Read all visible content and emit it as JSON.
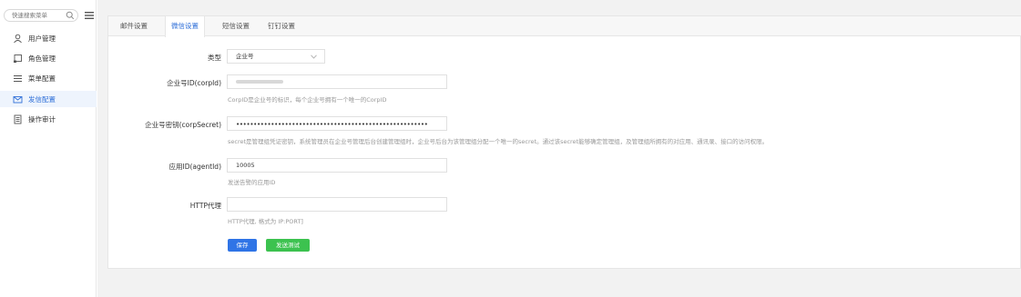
{
  "sidebar": {
    "search_placeholder": "快速搜索菜单",
    "items": [
      {
        "label": "用户管理",
        "icon": "user-icon"
      },
      {
        "label": "角色管理",
        "icon": "role-icon"
      },
      {
        "label": "菜单配置",
        "icon": "list-icon"
      },
      {
        "label": "发信配置",
        "icon": "mail-icon",
        "active": true
      },
      {
        "label": "操作审计",
        "icon": "audit-icon"
      }
    ]
  },
  "tabs": [
    {
      "label": "邮件设置"
    },
    {
      "label": "微信设置",
      "active": true
    },
    {
      "label": "短信设置"
    },
    {
      "label": "钉钉设置"
    }
  ],
  "form": {
    "type": {
      "label": "类型",
      "value": "企业号"
    },
    "corpid": {
      "label": "企业号ID(corpId)",
      "help": "CorpID是企业号的标识，每个企业号拥有一个唯一的CorpID"
    },
    "corpsecret": {
      "label": "企业号密钥(corpSecret)",
      "value": "••••••••••••••••••••••••••••••••••••••••••••••••••••••••••••••••••••",
      "help": "secret是管理组凭证密钥，系统管理员在企业号管理后台创建管理组时，企业号后台为该管理组分配一个唯一的secret。通过该secret能够确定管理组，及管理组所拥有的对应用、通讯录、接口的访问权限。"
    },
    "agentid": {
      "label": "应用ID(agentId)",
      "value": "10005",
      "help": "发送告警的应用ID"
    },
    "proxy": {
      "label": "HTTP代理",
      "value": "",
      "help": "HTTP代理, 格式为 IP:PORT]"
    }
  },
  "buttons": {
    "save": "保存",
    "test": "发送测试"
  },
  "colors": {
    "accent": "#2f6fd8",
    "save": "#2f74e6",
    "test": "#3cc24f"
  }
}
